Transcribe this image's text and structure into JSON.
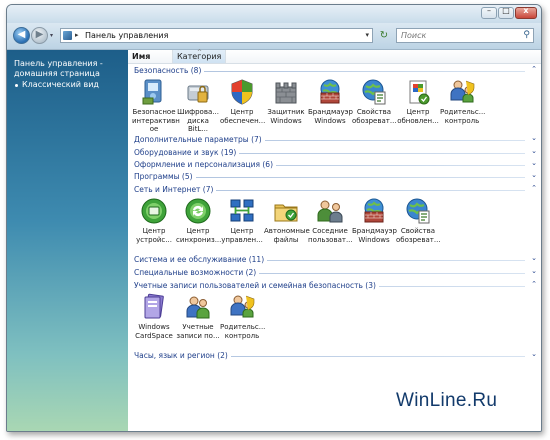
{
  "window": {
    "minimize_glyph": "–",
    "maximize_glyph": "□",
    "close_glyph": "x"
  },
  "navbar": {
    "back_glyph": "◀",
    "forward_glyph": "▶",
    "address_arrow": "▸",
    "address_text": "Панель управления",
    "address_dropdown": "▾",
    "refresh_glyph": "↻",
    "search_placeholder": "Поиск",
    "search_glyph": "⚲"
  },
  "sidebar": {
    "home_link": "Панель управления -\nдомашняя страница",
    "classic_link": "Классический вид"
  },
  "columns": {
    "name": "Имя",
    "category": "Категория",
    "sort_glyph": "^"
  },
  "groups": {
    "security": {
      "title": "Безопасность (8)",
      "items": [
        {
          "icon": "bitlocker-shield-icon",
          "label": "Безопасное\nинтерактивн\nое"
        },
        {
          "icon": "bitlocker-disk-icon",
          "label": "Шифрова...\nдиска BitL..."
        },
        {
          "icon": "security-center-shield-icon",
          "label": "Центр\nобеспечен..."
        },
        {
          "icon": "windows-defender-castle-icon",
          "label": "Защитник\nWindows"
        },
        {
          "icon": "firewall-globe-icon",
          "label": "Брандмауэр\nWindows"
        },
        {
          "icon": "internet-options-globe-icon",
          "label": "Свойства\nобозреват..."
        },
        {
          "icon": "update-center-icon",
          "label": "Центр\nобновлен..."
        },
        {
          "icon": "parental-controls-icon",
          "label": "Родительс...\nконтроль"
        }
      ]
    },
    "additional": {
      "title": "Дополнительные параметры (7)"
    },
    "hardware": {
      "title": "Оборудование и звук (19)"
    },
    "appearance": {
      "title": "Оформление и персонализация (6)"
    },
    "programs": {
      "title": "Программы (5)"
    },
    "network": {
      "title": "Сеть и Интернет (7)",
      "items": [
        {
          "icon": "device-center-icon",
          "label": "Центр\nустройс..."
        },
        {
          "icon": "sync-center-icon",
          "label": "Центр\nсинхрониз..."
        },
        {
          "icon": "network-center-icon",
          "label": "Центр\nуправлен..."
        },
        {
          "icon": "offline-files-folder-icon",
          "label": "Автономные\nфайлы"
        },
        {
          "icon": "people-near-me-icon",
          "label": "Соседние\nпользоват..."
        },
        {
          "icon": "firewall-globe-icon",
          "label": "Брандмауэр\nWindows"
        },
        {
          "icon": "internet-options-globe-icon",
          "label": "Свойства\nобозреват..."
        }
      ]
    },
    "system": {
      "title": "Система и ее обслуживание (11)"
    },
    "accessibility": {
      "title": "Специальные возможности (2)"
    },
    "accounts": {
      "title": "Учетные записи пользователей и семейная безопасность (3)",
      "items": [
        {
          "icon": "cardspace-icon",
          "label": "Windows\nCardSpace"
        },
        {
          "icon": "user-accounts-icon",
          "label": "Учетные\nзаписи по..."
        },
        {
          "icon": "parental-controls-icon",
          "label": "Родительс...\nконтроль"
        }
      ]
    },
    "clock": {
      "title": "Часы, язык и регион (2)"
    }
  },
  "chevrons": {
    "down": "⌄",
    "up": "⌃"
  },
  "watermark": "WinLine.Ru",
  "colors": {
    "sidebar_top": "#1d5e89",
    "group_title": "#1f3f8a",
    "watermark": "#123a6b"
  }
}
